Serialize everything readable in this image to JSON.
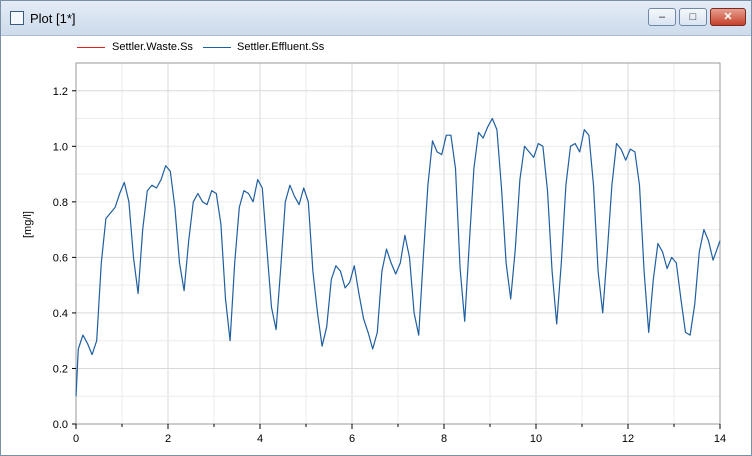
{
  "window": {
    "title": "Plot [1*]",
    "minimize_glyph": "–",
    "maximize_glyph": "□",
    "close_glyph": "✕"
  },
  "chart_data": {
    "type": "line",
    "ylabel": "[mg/l]",
    "xlim": [
      0,
      14
    ],
    "ylim": [
      0,
      1.3
    ],
    "x_ticks": [
      0,
      2,
      4,
      6,
      8,
      10,
      12,
      14
    ],
    "y_ticks": [
      0.0,
      0.2,
      0.4,
      0.6,
      0.8,
      1.0,
      1.2
    ],
    "x_tick_labels": [
      "0",
      "2",
      "4",
      "6",
      "8",
      "10",
      "12",
      "14"
    ],
    "y_tick_labels": [
      "0.0",
      "0.2",
      "0.4",
      "0.6",
      "0.8",
      "1.0",
      "1.2"
    ],
    "grid": true,
    "legend_position": "top-left",
    "series": [
      {
        "name": "Settler.Waste.Ss",
        "color": "#e02020",
        "x": [],
        "y": []
      },
      {
        "name": "Settler.Effluent.Ss",
        "color": "#1f5f9f",
        "x": [
          0,
          0.05,
          0.15,
          0.25,
          0.35,
          0.45,
          0.55,
          0.65,
          0.75,
          0.85,
          0.95,
          1.05,
          1.15,
          1.25,
          1.35,
          1.45,
          1.55,
          1.65,
          1.75,
          1.85,
          1.95,
          2.05,
          2.15,
          2.25,
          2.35,
          2.45,
          2.55,
          2.65,
          2.75,
          2.85,
          2.95,
          3.05,
          3.15,
          3.25,
          3.35,
          3.45,
          3.55,
          3.65,
          3.75,
          3.85,
          3.95,
          4.05,
          4.15,
          4.25,
          4.35,
          4.45,
          4.55,
          4.65,
          4.75,
          4.85,
          4.95,
          5.05,
          5.15,
          5.25,
          5.35,
          5.45,
          5.55,
          5.65,
          5.75,
          5.85,
          5.95,
          6.05,
          6.15,
          6.25,
          6.35,
          6.45,
          6.55,
          6.65,
          6.75,
          6.85,
          6.95,
          7.05,
          7.15,
          7.25,
          7.35,
          7.45,
          7.55,
          7.65,
          7.75,
          7.85,
          7.95,
          8.05,
          8.15,
          8.25,
          8.35,
          8.45,
          8.55,
          8.65,
          8.75,
          8.85,
          8.95,
          9.05,
          9.15,
          9.25,
          9.35,
          9.45,
          9.55,
          9.65,
          9.75,
          9.85,
          9.95,
          10.05,
          10.15,
          10.25,
          10.35,
          10.45,
          10.55,
          10.65,
          10.75,
          10.85,
          10.95,
          11.05,
          11.15,
          11.25,
          11.35,
          11.45,
          11.55,
          11.65,
          11.75,
          11.85,
          11.95,
          12.05,
          12.15,
          12.25,
          12.35,
          12.45,
          12.55,
          12.65,
          12.75,
          12.85,
          12.95,
          13.05,
          13.15,
          13.25,
          13.35,
          13.45,
          13.55,
          13.65,
          13.75,
          13.85,
          14.0
        ],
        "y": [
          0.1,
          0.27,
          0.32,
          0.29,
          0.25,
          0.3,
          0.58,
          0.74,
          0.76,
          0.78,
          0.83,
          0.87,
          0.8,
          0.6,
          0.47,
          0.7,
          0.84,
          0.86,
          0.85,
          0.88,
          0.93,
          0.91,
          0.78,
          0.58,
          0.48,
          0.66,
          0.8,
          0.83,
          0.8,
          0.79,
          0.84,
          0.83,
          0.72,
          0.45,
          0.3,
          0.58,
          0.78,
          0.84,
          0.83,
          0.8,
          0.88,
          0.85,
          0.63,
          0.42,
          0.34,
          0.56,
          0.8,
          0.86,
          0.82,
          0.79,
          0.85,
          0.8,
          0.55,
          0.4,
          0.28,
          0.35,
          0.52,
          0.57,
          0.55,
          0.49,
          0.51,
          0.57,
          0.47,
          0.38,
          0.33,
          0.27,
          0.33,
          0.55,
          0.63,
          0.58,
          0.54,
          0.58,
          0.68,
          0.6,
          0.4,
          0.32,
          0.6,
          0.86,
          1.02,
          0.98,
          0.97,
          1.04,
          1.04,
          0.92,
          0.56,
          0.37,
          0.65,
          0.92,
          1.05,
          1.03,
          1.07,
          1.1,
          1.06,
          0.85,
          0.58,
          0.45,
          0.63,
          0.88,
          1.0,
          0.98,
          0.96,
          1.01,
          1.0,
          0.84,
          0.55,
          0.36,
          0.58,
          0.86,
          1.0,
          1.01,
          0.98,
          1.06,
          1.04,
          0.86,
          0.55,
          0.4,
          0.62,
          0.86,
          1.01,
          0.99,
          0.95,
          0.99,
          0.98,
          0.86,
          0.55,
          0.33,
          0.52,
          0.65,
          0.62,
          0.56,
          0.6,
          0.58,
          0.45,
          0.33,
          0.32,
          0.43,
          0.62,
          0.7,
          0.66,
          0.59,
          0.66
        ]
      }
    ]
  }
}
